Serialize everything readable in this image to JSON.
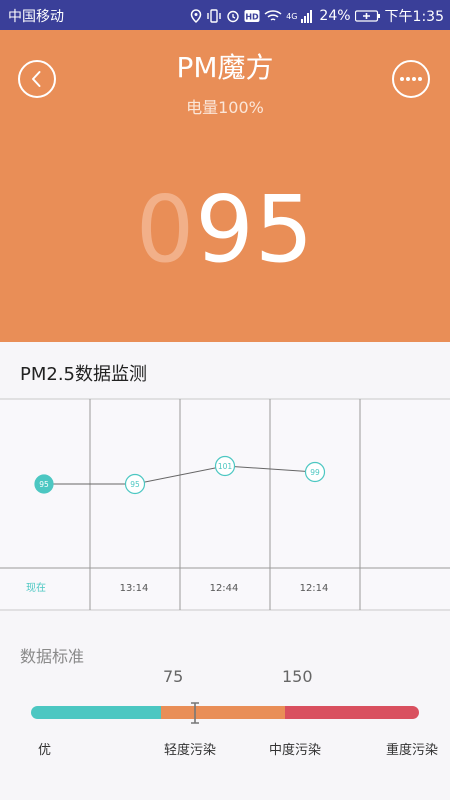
{
  "status_bar": {
    "carrier": "中国移动",
    "network": "4G",
    "battery_pct": "24%",
    "time": "下午1:35"
  },
  "header": {
    "title": "PM魔方",
    "battery_text": "电量100%",
    "reading_lead": "0",
    "reading_value": "95",
    "bg_color": "#e98e57"
  },
  "section": {
    "title": "PM2.5数据监测"
  },
  "chart_data": {
    "type": "line",
    "x": [
      "现在",
      "13:14",
      "12:44",
      "12:14"
    ],
    "values": [
      95,
      95,
      101,
      99
    ],
    "point_labels": [
      "95",
      "95",
      "101",
      "99"
    ],
    "accent_color": "#4cc7c2",
    "grid": true
  },
  "standard": {
    "label": "数据标准",
    "thresholds": [
      "75",
      "150"
    ],
    "levels": [
      "优",
      "轻度污染",
      "中度污染",
      "重度污染"
    ],
    "colors": [
      "#4cc7c2",
      "#e98e57",
      "#d9505f"
    ],
    "current_value": 95
  }
}
